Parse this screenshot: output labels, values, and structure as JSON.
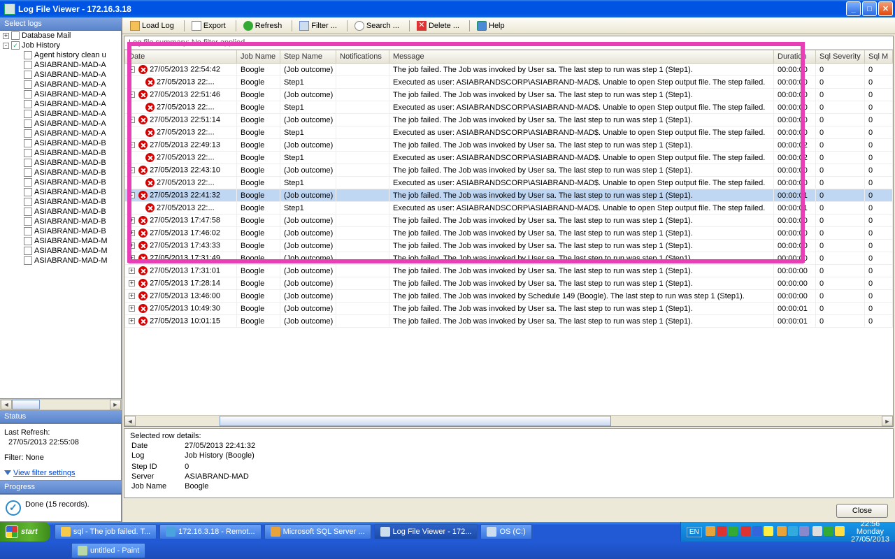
{
  "title": "Log File Viewer - 172.16.3.18",
  "sidebar": {
    "select_logs": "Select logs",
    "tree": [
      {
        "pm": "+",
        "cb": "",
        "lbl": "Database Mail",
        "ind": 0
      },
      {
        "pm": "-",
        "cb": "✓",
        "lbl": "Job History",
        "ind": 0
      },
      {
        "pm": "",
        "cb": "",
        "lbl": "Agent history clean u",
        "ind": 1
      },
      {
        "pm": "",
        "cb": "",
        "lbl": "ASIABRAND-MAD-A",
        "ind": 1
      },
      {
        "pm": "",
        "cb": "",
        "lbl": "ASIABRAND-MAD-A",
        "ind": 1
      },
      {
        "pm": "",
        "cb": "",
        "lbl": "ASIABRAND-MAD-A",
        "ind": 1
      },
      {
        "pm": "",
        "cb": "",
        "lbl": "ASIABRAND-MAD-A",
        "ind": 1
      },
      {
        "pm": "",
        "cb": "",
        "lbl": "ASIABRAND-MAD-A",
        "ind": 1
      },
      {
        "pm": "",
        "cb": "",
        "lbl": "ASIABRAND-MAD-A",
        "ind": 1
      },
      {
        "pm": "",
        "cb": "",
        "lbl": "ASIABRAND-MAD-A",
        "ind": 1
      },
      {
        "pm": "",
        "cb": "",
        "lbl": "ASIABRAND-MAD-A",
        "ind": 1
      },
      {
        "pm": "",
        "cb": "",
        "lbl": "ASIABRAND-MAD-B",
        "ind": 1
      },
      {
        "pm": "",
        "cb": "",
        "lbl": "ASIABRAND-MAD-B",
        "ind": 1
      },
      {
        "pm": "",
        "cb": "",
        "lbl": "ASIABRAND-MAD-B",
        "ind": 1
      },
      {
        "pm": "",
        "cb": "",
        "lbl": "ASIABRAND-MAD-B",
        "ind": 1
      },
      {
        "pm": "",
        "cb": "",
        "lbl": "ASIABRAND-MAD-B",
        "ind": 1
      },
      {
        "pm": "",
        "cb": "",
        "lbl": "ASIABRAND-MAD-B",
        "ind": 1
      },
      {
        "pm": "",
        "cb": "",
        "lbl": "ASIABRAND-MAD-B",
        "ind": 1
      },
      {
        "pm": "",
        "cb": "",
        "lbl": "ASIABRAND-MAD-B",
        "ind": 1
      },
      {
        "pm": "",
        "cb": "",
        "lbl": "ASIABRAND-MAD-B",
        "ind": 1
      },
      {
        "pm": "",
        "cb": "",
        "lbl": "ASIABRAND-MAD-B",
        "ind": 1
      },
      {
        "pm": "",
        "cb": "",
        "lbl": "ASIABRAND-MAD-M",
        "ind": 1
      },
      {
        "pm": "",
        "cb": "",
        "lbl": "ASIABRAND-MAD-M",
        "ind": 1
      },
      {
        "pm": "",
        "cb": "",
        "lbl": "ASIABRAND-MAD-M",
        "ind": 1
      }
    ],
    "status_hdr": "Status",
    "last_refresh_lbl": "Last Refresh:",
    "last_refresh_val": "27/05/2013 22:55:08",
    "filter": "Filter: None",
    "filter_link": "View filter settings",
    "progress_hdr": "Progress",
    "done": "Done (15 records)."
  },
  "toolbar": {
    "load": "Load Log",
    "export": "Export",
    "refresh": "Refresh",
    "filter": "Filter ...",
    "search": "Search ...",
    "delete": "Delete ...",
    "help": "Help"
  },
  "crumb": "Log file summary: No filter applied",
  "cols": [
    "Date",
    "Job Name",
    "Step Name",
    "Notifications",
    "Message",
    "Duration",
    "Sql Severity",
    "Sql M"
  ],
  "rows": [
    {
      "exp": "-",
      "ind": 0,
      "date": "27/05/2013 22:54:42",
      "job": "Boogle",
      "step": "(Job outcome)",
      "msg": "The job failed.  The Job was invoked by User sa.  The last step to run was step 1 (Step1).",
      "dur": "00:00:00",
      "sev": "0",
      "sm": "0"
    },
    {
      "exp": "",
      "ind": 1,
      "date": "27/05/2013 22:...",
      "job": "Boogle",
      "step": "Step1",
      "msg": "Executed as user: ASIABRANDSCORP\\ASIABRAND-MAD$. Unable to open Step output file.  The step failed.",
      "dur": "00:00:00",
      "sev": "0",
      "sm": "0"
    },
    {
      "exp": "-",
      "ind": 0,
      "date": "27/05/2013 22:51:46",
      "job": "Boogle",
      "step": "(Job outcome)",
      "msg": "The job failed.  The Job was invoked by User sa.  The last step to run was step 1 (Step1).",
      "dur": "00:00:00",
      "sev": "0",
      "sm": "0"
    },
    {
      "exp": "",
      "ind": 1,
      "date": "27/05/2013 22:...",
      "job": "Boogle",
      "step": "Step1",
      "msg": "Executed as user: ASIABRANDSCORP\\ASIABRAND-MAD$. Unable to open Step output file.  The step failed.",
      "dur": "00:00:00",
      "sev": "0",
      "sm": "0"
    },
    {
      "exp": "-",
      "ind": 0,
      "date": "27/05/2013 22:51:14",
      "job": "Boogle",
      "step": "(Job outcome)",
      "msg": "The job failed.  The Job was invoked by User sa.  The last step to run was step 1 (Step1).",
      "dur": "00:00:00",
      "sev": "0",
      "sm": "0"
    },
    {
      "exp": "",
      "ind": 1,
      "date": "27/05/2013 22:...",
      "job": "Boogle",
      "step": "Step1",
      "msg": "Executed as user: ASIABRANDSCORP\\ASIABRAND-MAD$. Unable to open Step output file.  The step failed.",
      "dur": "00:00:00",
      "sev": "0",
      "sm": "0"
    },
    {
      "exp": "-",
      "ind": 0,
      "date": "27/05/2013 22:49:13",
      "job": "Boogle",
      "step": "(Job outcome)",
      "msg": "The job failed.  The Job was invoked by User sa.  The last step to run was step 1 (Step1).",
      "dur": "00:00:02",
      "sev": "0",
      "sm": "0"
    },
    {
      "exp": "",
      "ind": 1,
      "date": "27/05/2013 22:...",
      "job": "Boogle",
      "step": "Step1",
      "msg": "Executed as user: ASIABRANDSCORP\\ASIABRAND-MAD$. Unable to open Step output file.  The step failed.",
      "dur": "00:00:02",
      "sev": "0",
      "sm": "0"
    },
    {
      "exp": "-",
      "ind": 0,
      "date": "27/05/2013 22:43:10",
      "job": "Boogle",
      "step": "(Job outcome)",
      "msg": "The job failed.  The Job was invoked by User sa.  The last step to run was step 1 (Step1).",
      "dur": "00:00:00",
      "sev": "0",
      "sm": "0"
    },
    {
      "exp": "",
      "ind": 1,
      "date": "27/05/2013 22:...",
      "job": "Boogle",
      "step": "Step1",
      "msg": "Executed as user: ASIABRANDSCORP\\ASIABRAND-MAD$. Unable to open Step output file.  The step failed.",
      "dur": "00:00:00",
      "sev": "0",
      "sm": "0"
    },
    {
      "exp": "-",
      "ind": 0,
      "date": "27/05/2013 22:41:32",
      "job": "Boogle",
      "step": "(Job outcome)",
      "msg": "The job failed.  The Job was invoked by User sa.  The last step to run was step 1 (Step1).",
      "dur": "00:00:01",
      "sev": "0",
      "sm": "0",
      "sel": true
    },
    {
      "exp": "",
      "ind": 1,
      "date": "27/05/2013 22:...",
      "job": "Boogle",
      "step": "Step1",
      "msg": "Executed as user: ASIABRANDSCORP\\ASIABRAND-MAD$. Unable to open Step output file.  The step failed.",
      "dur": "00:00:01",
      "sev": "0",
      "sm": "0"
    },
    {
      "exp": "+",
      "ind": 0,
      "date": "27/05/2013 17:47:58",
      "job": "Boogle",
      "step": "(Job outcome)",
      "msg": "The job failed.  The Job was invoked by User sa.  The last step to run was step 1 (Step1).",
      "dur": "00:00:00",
      "sev": "0",
      "sm": "0"
    },
    {
      "exp": "+",
      "ind": 0,
      "date": "27/05/2013 17:46:02",
      "job": "Boogle",
      "step": "(Job outcome)",
      "msg": "The job failed.  The Job was invoked by User sa.  The last step to run was step 1 (Step1).",
      "dur": "00:00:00",
      "sev": "0",
      "sm": "0"
    },
    {
      "exp": "+",
      "ind": 0,
      "date": "27/05/2013 17:43:33",
      "job": "Boogle",
      "step": "(Job outcome)",
      "msg": "The job failed.  The Job was invoked by User sa.  The last step to run was step 1 (Step1).",
      "dur": "00:00:00",
      "sev": "0",
      "sm": "0"
    },
    {
      "exp": "+",
      "ind": 0,
      "date": "27/05/2013 17:31:49",
      "job": "Boogle",
      "step": "(Job outcome)",
      "msg": "The job failed.  The Job was invoked by User sa.  The last step to run was step 1 (Step1).",
      "dur": "00:00:00",
      "sev": "0",
      "sm": "0"
    },
    {
      "exp": "+",
      "ind": 0,
      "date": "27/05/2013 17:31:01",
      "job": "Boogle",
      "step": "(Job outcome)",
      "msg": "The job failed.  The Job was invoked by User sa.  The last step to run was step 1 (Step1).",
      "dur": "00:00:00",
      "sev": "0",
      "sm": "0"
    },
    {
      "exp": "+",
      "ind": 0,
      "date": "27/05/2013 17:28:14",
      "job": "Boogle",
      "step": "(Job outcome)",
      "msg": "The job failed.  The Job was invoked by User sa.  The last step to run was step 1 (Step1).",
      "dur": "00:00:00",
      "sev": "0",
      "sm": "0"
    },
    {
      "exp": "+",
      "ind": 0,
      "date": "27/05/2013 13:46:00",
      "job": "Boogle",
      "step": "(Job outcome)",
      "msg": "The job failed.  The Job was invoked by Schedule 149 (Boogle).  The last step to run was step 1 (Step1).",
      "dur": "00:00:00",
      "sev": "0",
      "sm": "0"
    },
    {
      "exp": "+",
      "ind": 0,
      "date": "27/05/2013 10:49:30",
      "job": "Boogle",
      "step": "(Job outcome)",
      "msg": "The job failed.  The Job was invoked by User sa.  The last step to run was step 1 (Step1).",
      "dur": "00:00:01",
      "sev": "0",
      "sm": "0"
    },
    {
      "exp": "+",
      "ind": 0,
      "date": "27/05/2013 10:01:15",
      "job": "Boogle",
      "step": "(Job outcome)",
      "msg": "The job failed.  The Job was invoked by User sa.  The last step to run was step 1 (Step1).",
      "dur": "00:00:01",
      "sev": "0",
      "sm": "0"
    }
  ],
  "details": {
    "hdr": "Selected row details:",
    "rows": [
      [
        "Date",
        "27/05/2013 22:41:32"
      ],
      [
        "Log",
        "Job History (Boogle)"
      ],
      [
        "",
        ""
      ],
      [
        "Step ID",
        "0"
      ],
      [
        "Server",
        "ASIABRAND-MAD"
      ],
      [
        "Job Name",
        "Boogle"
      ]
    ]
  },
  "close_btn": "Close",
  "taskbar": {
    "start": "start",
    "tasks": [
      {
        "lbl": "sql - The job failed. T...",
        "color": "#f7c948"
      },
      {
        "lbl": "172.16.3.18 - Remot...",
        "color": "#4aa3df"
      },
      {
        "lbl": "Microsoft SQL Server ...",
        "color": "#e8a33b"
      },
      {
        "lbl": "Log File Viewer - 172...",
        "color": "#cde",
        "active": true
      },
      {
        "lbl": "OS (C:)",
        "color": "#cde"
      }
    ],
    "task2": "untitled - Paint",
    "lang": "EN",
    "time": "22:56",
    "day": "Monday",
    "date": "27/05/2013"
  }
}
